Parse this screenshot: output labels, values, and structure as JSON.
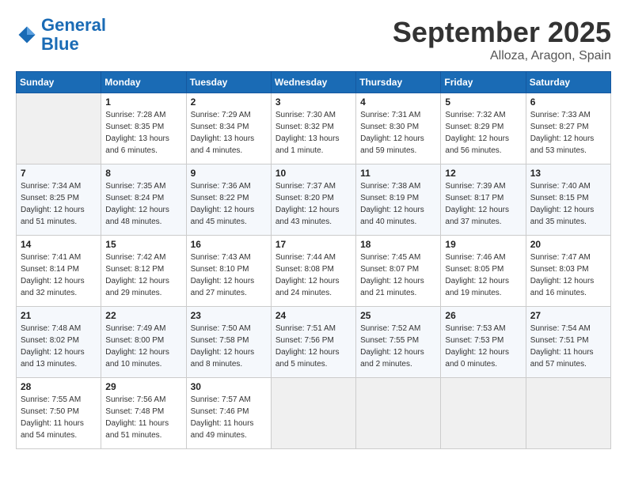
{
  "header": {
    "logo_general": "General",
    "logo_blue": "Blue",
    "month_title": "September 2025",
    "location": "Alloza, Aragon, Spain"
  },
  "days_of_week": [
    "Sunday",
    "Monday",
    "Tuesday",
    "Wednesday",
    "Thursday",
    "Friday",
    "Saturday"
  ],
  "weeks": [
    [
      {
        "day": "",
        "sunrise": "",
        "sunset": "",
        "daylight": ""
      },
      {
        "day": "1",
        "sunrise": "Sunrise: 7:28 AM",
        "sunset": "Sunset: 8:35 PM",
        "daylight": "Daylight: 13 hours and 6 minutes."
      },
      {
        "day": "2",
        "sunrise": "Sunrise: 7:29 AM",
        "sunset": "Sunset: 8:34 PM",
        "daylight": "Daylight: 13 hours and 4 minutes."
      },
      {
        "day": "3",
        "sunrise": "Sunrise: 7:30 AM",
        "sunset": "Sunset: 8:32 PM",
        "daylight": "Daylight: 13 hours and 1 minute."
      },
      {
        "day": "4",
        "sunrise": "Sunrise: 7:31 AM",
        "sunset": "Sunset: 8:30 PM",
        "daylight": "Daylight: 12 hours and 59 minutes."
      },
      {
        "day": "5",
        "sunrise": "Sunrise: 7:32 AM",
        "sunset": "Sunset: 8:29 PM",
        "daylight": "Daylight: 12 hours and 56 minutes."
      },
      {
        "day": "6",
        "sunrise": "Sunrise: 7:33 AM",
        "sunset": "Sunset: 8:27 PM",
        "daylight": "Daylight: 12 hours and 53 minutes."
      }
    ],
    [
      {
        "day": "7",
        "sunrise": "Sunrise: 7:34 AM",
        "sunset": "Sunset: 8:25 PM",
        "daylight": "Daylight: 12 hours and 51 minutes."
      },
      {
        "day": "8",
        "sunrise": "Sunrise: 7:35 AM",
        "sunset": "Sunset: 8:24 PM",
        "daylight": "Daylight: 12 hours and 48 minutes."
      },
      {
        "day": "9",
        "sunrise": "Sunrise: 7:36 AM",
        "sunset": "Sunset: 8:22 PM",
        "daylight": "Daylight: 12 hours and 45 minutes."
      },
      {
        "day": "10",
        "sunrise": "Sunrise: 7:37 AM",
        "sunset": "Sunset: 8:20 PM",
        "daylight": "Daylight: 12 hours and 43 minutes."
      },
      {
        "day": "11",
        "sunrise": "Sunrise: 7:38 AM",
        "sunset": "Sunset: 8:19 PM",
        "daylight": "Daylight: 12 hours and 40 minutes."
      },
      {
        "day": "12",
        "sunrise": "Sunrise: 7:39 AM",
        "sunset": "Sunset: 8:17 PM",
        "daylight": "Daylight: 12 hours and 37 minutes."
      },
      {
        "day": "13",
        "sunrise": "Sunrise: 7:40 AM",
        "sunset": "Sunset: 8:15 PM",
        "daylight": "Daylight: 12 hours and 35 minutes."
      }
    ],
    [
      {
        "day": "14",
        "sunrise": "Sunrise: 7:41 AM",
        "sunset": "Sunset: 8:14 PM",
        "daylight": "Daylight: 12 hours and 32 minutes."
      },
      {
        "day": "15",
        "sunrise": "Sunrise: 7:42 AM",
        "sunset": "Sunset: 8:12 PM",
        "daylight": "Daylight: 12 hours and 29 minutes."
      },
      {
        "day": "16",
        "sunrise": "Sunrise: 7:43 AM",
        "sunset": "Sunset: 8:10 PM",
        "daylight": "Daylight: 12 hours and 27 minutes."
      },
      {
        "day": "17",
        "sunrise": "Sunrise: 7:44 AM",
        "sunset": "Sunset: 8:08 PM",
        "daylight": "Daylight: 12 hours and 24 minutes."
      },
      {
        "day": "18",
        "sunrise": "Sunrise: 7:45 AM",
        "sunset": "Sunset: 8:07 PM",
        "daylight": "Daylight: 12 hours and 21 minutes."
      },
      {
        "day": "19",
        "sunrise": "Sunrise: 7:46 AM",
        "sunset": "Sunset: 8:05 PM",
        "daylight": "Daylight: 12 hours and 19 minutes."
      },
      {
        "day": "20",
        "sunrise": "Sunrise: 7:47 AM",
        "sunset": "Sunset: 8:03 PM",
        "daylight": "Daylight: 12 hours and 16 minutes."
      }
    ],
    [
      {
        "day": "21",
        "sunrise": "Sunrise: 7:48 AM",
        "sunset": "Sunset: 8:02 PM",
        "daylight": "Daylight: 12 hours and 13 minutes."
      },
      {
        "day": "22",
        "sunrise": "Sunrise: 7:49 AM",
        "sunset": "Sunset: 8:00 PM",
        "daylight": "Daylight: 12 hours and 10 minutes."
      },
      {
        "day": "23",
        "sunrise": "Sunrise: 7:50 AM",
        "sunset": "Sunset: 7:58 PM",
        "daylight": "Daylight: 12 hours and 8 minutes."
      },
      {
        "day": "24",
        "sunrise": "Sunrise: 7:51 AM",
        "sunset": "Sunset: 7:56 PM",
        "daylight": "Daylight: 12 hours and 5 minutes."
      },
      {
        "day": "25",
        "sunrise": "Sunrise: 7:52 AM",
        "sunset": "Sunset: 7:55 PM",
        "daylight": "Daylight: 12 hours and 2 minutes."
      },
      {
        "day": "26",
        "sunrise": "Sunrise: 7:53 AM",
        "sunset": "Sunset: 7:53 PM",
        "daylight": "Daylight: 12 hours and 0 minutes."
      },
      {
        "day": "27",
        "sunrise": "Sunrise: 7:54 AM",
        "sunset": "Sunset: 7:51 PM",
        "daylight": "Daylight: 11 hours and 57 minutes."
      }
    ],
    [
      {
        "day": "28",
        "sunrise": "Sunrise: 7:55 AM",
        "sunset": "Sunset: 7:50 PM",
        "daylight": "Daylight: 11 hours and 54 minutes."
      },
      {
        "day": "29",
        "sunrise": "Sunrise: 7:56 AM",
        "sunset": "Sunset: 7:48 PM",
        "daylight": "Daylight: 11 hours and 51 minutes."
      },
      {
        "day": "30",
        "sunrise": "Sunrise: 7:57 AM",
        "sunset": "Sunset: 7:46 PM",
        "daylight": "Daylight: 11 hours and 49 minutes."
      },
      {
        "day": "",
        "sunrise": "",
        "sunset": "",
        "daylight": ""
      },
      {
        "day": "",
        "sunrise": "",
        "sunset": "",
        "daylight": ""
      },
      {
        "day": "",
        "sunrise": "",
        "sunset": "",
        "daylight": ""
      },
      {
        "day": "",
        "sunrise": "",
        "sunset": "",
        "daylight": ""
      }
    ]
  ]
}
